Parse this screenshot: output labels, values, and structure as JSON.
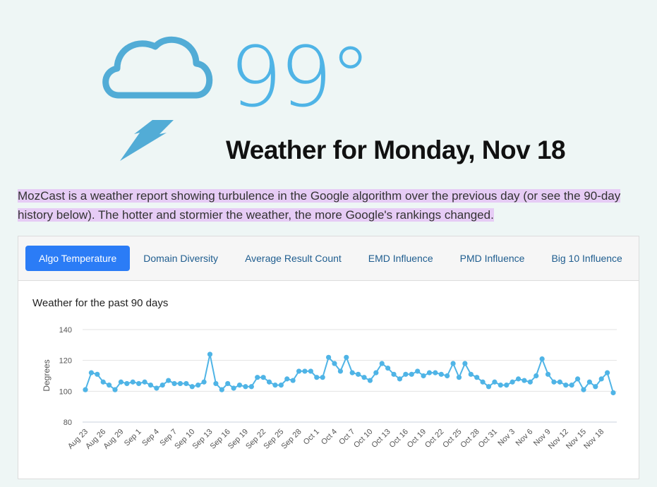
{
  "hero": {
    "icon": "storm-cloud-lightning-icon",
    "temperature": "99°",
    "headline": "Weather for Monday, Nov 18"
  },
  "intro": {
    "text_line": "MozCast is a weather report showing turbulence in the Google algorithm over the previous day (or see the 90-day history below). The hotter and stormier the weather, the more Google's rankings changed."
  },
  "tabs": [
    {
      "label": "Algo Temperature",
      "active": true
    },
    {
      "label": "Domain Diversity",
      "active": false
    },
    {
      "label": "Average Result Count",
      "active": false
    },
    {
      "label": "EMD Influence",
      "active": false
    },
    {
      "label": "PMD Influence",
      "active": false
    },
    {
      "label": "Big 10 Influence",
      "active": false
    }
  ],
  "colors": {
    "accent": "#2b7cf6",
    "series": "#4fb4e6",
    "highlight": "#e6ccf5",
    "background": "#eef6f5"
  },
  "chart_data": {
    "type": "line",
    "title": "Weather for the past 90 days",
    "xlabel": "",
    "ylabel": "Degrees",
    "ylim": [
      80,
      140
    ],
    "yticks": [
      80,
      100,
      120,
      140
    ],
    "grid": true,
    "legend": "none",
    "start_date": "Aug 23",
    "end_date": "Nov 18",
    "x_tick_labels": [
      "Aug 23",
      "Aug 26",
      "Aug 29",
      "Sep 1",
      "Sep 4",
      "Sep 7",
      "Sep 10",
      "Sep 13",
      "Sep 16",
      "Sep 19",
      "Sep 22",
      "Sep 25",
      "Sep 28",
      "Oct 1",
      "Oct 4",
      "Oct 7",
      "Oct 10",
      "Oct 13",
      "Oct 16",
      "Oct 19",
      "Oct 22",
      "Oct 25",
      "Oct 28",
      "Oct 31",
      "Nov 3",
      "Nov 6",
      "Nov 9",
      "Nov 12",
      "Nov 15",
      "Nov 18"
    ],
    "series": [
      {
        "name": "Algo Temperature",
        "values": [
          101,
          112,
          111,
          106,
          104,
          101,
          106,
          105,
          106,
          105,
          106,
          104,
          102,
          104,
          107,
          105,
          105,
          105,
          103,
          104,
          106,
          124,
          105,
          101,
          105,
          102,
          104,
          103,
          103,
          109,
          109,
          106,
          104,
          104,
          108,
          107,
          113,
          113,
          113,
          109,
          109,
          122,
          118,
          113,
          122,
          112,
          111,
          109,
          107,
          112,
          118,
          115,
          111,
          108,
          111,
          111,
          113,
          110,
          112,
          112,
          111,
          110,
          118,
          109,
          118,
          111,
          109,
          106,
          103,
          106,
          104,
          104,
          106,
          108,
          107,
          106,
          110,
          121,
          111,
          106,
          106,
          104,
          104,
          108,
          101,
          106,
          103,
          108,
          112,
          99
        ]
      }
    ]
  }
}
